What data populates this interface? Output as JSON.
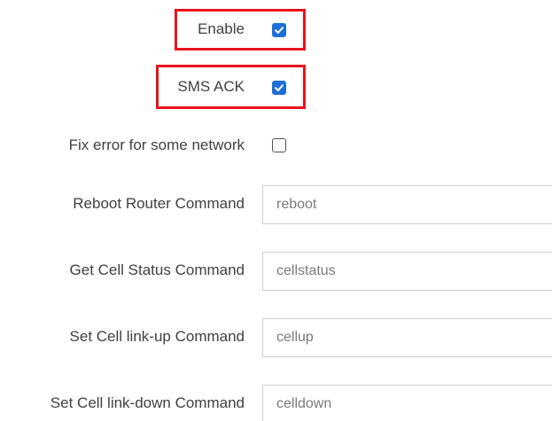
{
  "form": {
    "enable": {
      "label": "Enable",
      "checked": true
    },
    "sms_ack": {
      "label": "SMS ACK",
      "checked": true
    },
    "fix_error": {
      "label": "Fix error for some network",
      "checked": false
    },
    "reboot": {
      "label": "Reboot Router Command",
      "value": "reboot"
    },
    "cell_status": {
      "label": "Get Cell Status Command",
      "value": "cellstatus"
    },
    "link_up": {
      "label": "Set Cell link-up Command",
      "value": "cellup"
    },
    "link_down": {
      "label": "Set Cell link-down Command",
      "value": "celldown"
    }
  },
  "colors": {
    "highlight": "#e8141c",
    "checkbox_checked": "#1e6fd9"
  }
}
